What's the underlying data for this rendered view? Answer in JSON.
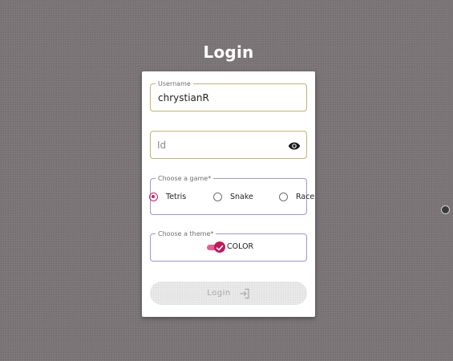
{
  "page": {
    "title": "Login"
  },
  "form": {
    "username": {
      "label": "Username",
      "value": "chrystianR"
    },
    "id": {
      "placeholder": "Id",
      "visibility_icon": "eye-icon"
    },
    "game": {
      "label": "Choose a game*",
      "options": [
        "Tetris",
        "Snake",
        "Race"
      ],
      "selected": "Tetris"
    },
    "theme": {
      "label": "Choose a theme*",
      "toggle_label": "COLOR",
      "enabled": true
    },
    "submit": {
      "label": "Login",
      "icon": "login-icon",
      "disabled": true
    }
  },
  "colors": {
    "background": "#7b7577",
    "accent": "#d81b60",
    "field_border": "#bdb76b",
    "field_border_focus": "#a093d8"
  }
}
